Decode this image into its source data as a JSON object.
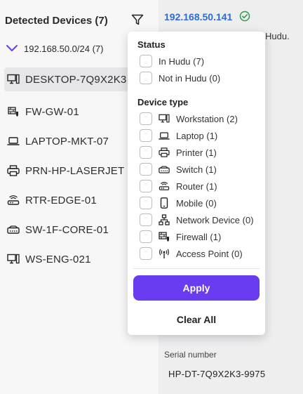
{
  "sidebar": {
    "title": "Detected Devices (7)",
    "subnet": "192.168.50.0/24 (7)",
    "devices": [
      {
        "label": "DESKTOP-7Q9X2K3",
        "icon": "workstation-icon"
      },
      {
        "label": "FW-GW-01",
        "icon": "firewall-icon"
      },
      {
        "label": "LAPTOP-MKT-07",
        "icon": "laptop-icon"
      },
      {
        "label": "PRN-HP-LASERJET",
        "icon": "printer-icon"
      },
      {
        "label": "RTR-EDGE-01",
        "icon": "router-icon"
      },
      {
        "label": "SW-1F-CORE-01",
        "icon": "switch-icon"
      },
      {
        "label": "WS-ENG-021",
        "icon": "workstation-icon"
      }
    ]
  },
  "detail": {
    "ip": "192.168.50.141",
    "hudu_fragment": "Hudu.",
    "serial_label": "Serial number",
    "serial_value": "HP-DT-7Q9X2K3-9975"
  },
  "filter": {
    "status_title": "Status",
    "status_options": [
      {
        "label": "In Hudu (7)"
      },
      {
        "label": "Not in Hudu (0)"
      }
    ],
    "device_type_title": "Device type",
    "device_type_options": [
      {
        "label": "Workstation (2)",
        "icon": "workstation-icon"
      },
      {
        "label": "Laptop (1)",
        "icon": "laptop-icon"
      },
      {
        "label": "Printer (1)",
        "icon": "printer-icon"
      },
      {
        "label": "Switch (1)",
        "icon": "switch-icon"
      },
      {
        "label": "Router (1)",
        "icon": "router-icon"
      },
      {
        "label": "Mobile (0)",
        "icon": "mobile-icon"
      },
      {
        "label": "Network Device (0)",
        "icon": "network-device-icon"
      },
      {
        "label": "Firewall (1)",
        "icon": "firewall-icon"
      },
      {
        "label": "Access Point (0)",
        "icon": "access-point-icon"
      }
    ],
    "apply_label": "Apply",
    "clear_label": "Clear All"
  },
  "colors": {
    "accent": "#6a3cf0",
    "link": "#2e6bd6",
    "success": "#2a9d4a"
  }
}
